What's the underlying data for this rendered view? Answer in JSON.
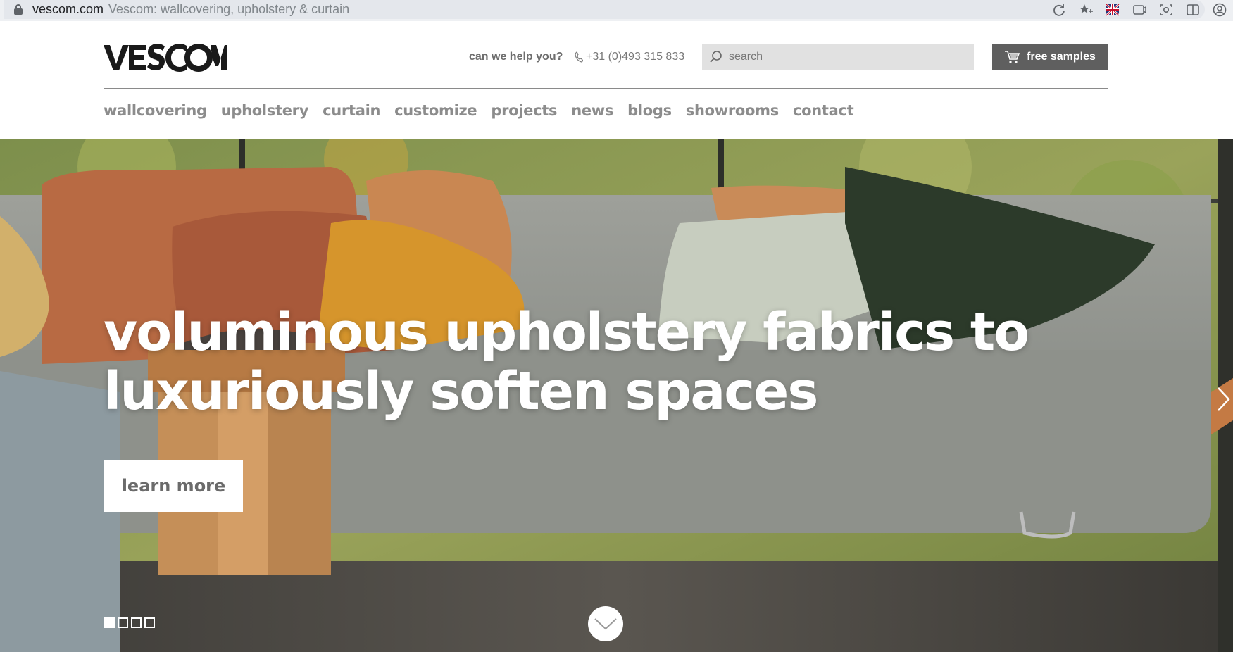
{
  "browser": {
    "domain": "vescom.com",
    "title": "Vescom: wallcovering, upholstery & curtain",
    "icons": [
      "reload-icon",
      "star-icon",
      "flag-uk-icon",
      "video-icon",
      "capture-icon",
      "split-view-icon",
      "profile-icon"
    ]
  },
  "header": {
    "logo_text": "VESCOM",
    "help_label": "can we help you?",
    "phone": "+31 (0)493 315 833",
    "search_placeholder": "search",
    "samples_label": "free samples"
  },
  "nav": {
    "items": [
      "wallcovering",
      "upholstery",
      "curtain",
      "customize",
      "projects",
      "news",
      "blogs",
      "showrooms",
      "contact"
    ]
  },
  "hero": {
    "headline_line1": "voluminous upholstery fabrics to",
    "headline_line2": "luxuriously soften spaces",
    "cta_label": "learn more",
    "slide_count": 4,
    "active_slide": 1
  },
  "colors": {
    "nav_text": "#8c8c8c",
    "button_dark": "#5f5f5f",
    "search_bg": "#e1e1e1"
  }
}
